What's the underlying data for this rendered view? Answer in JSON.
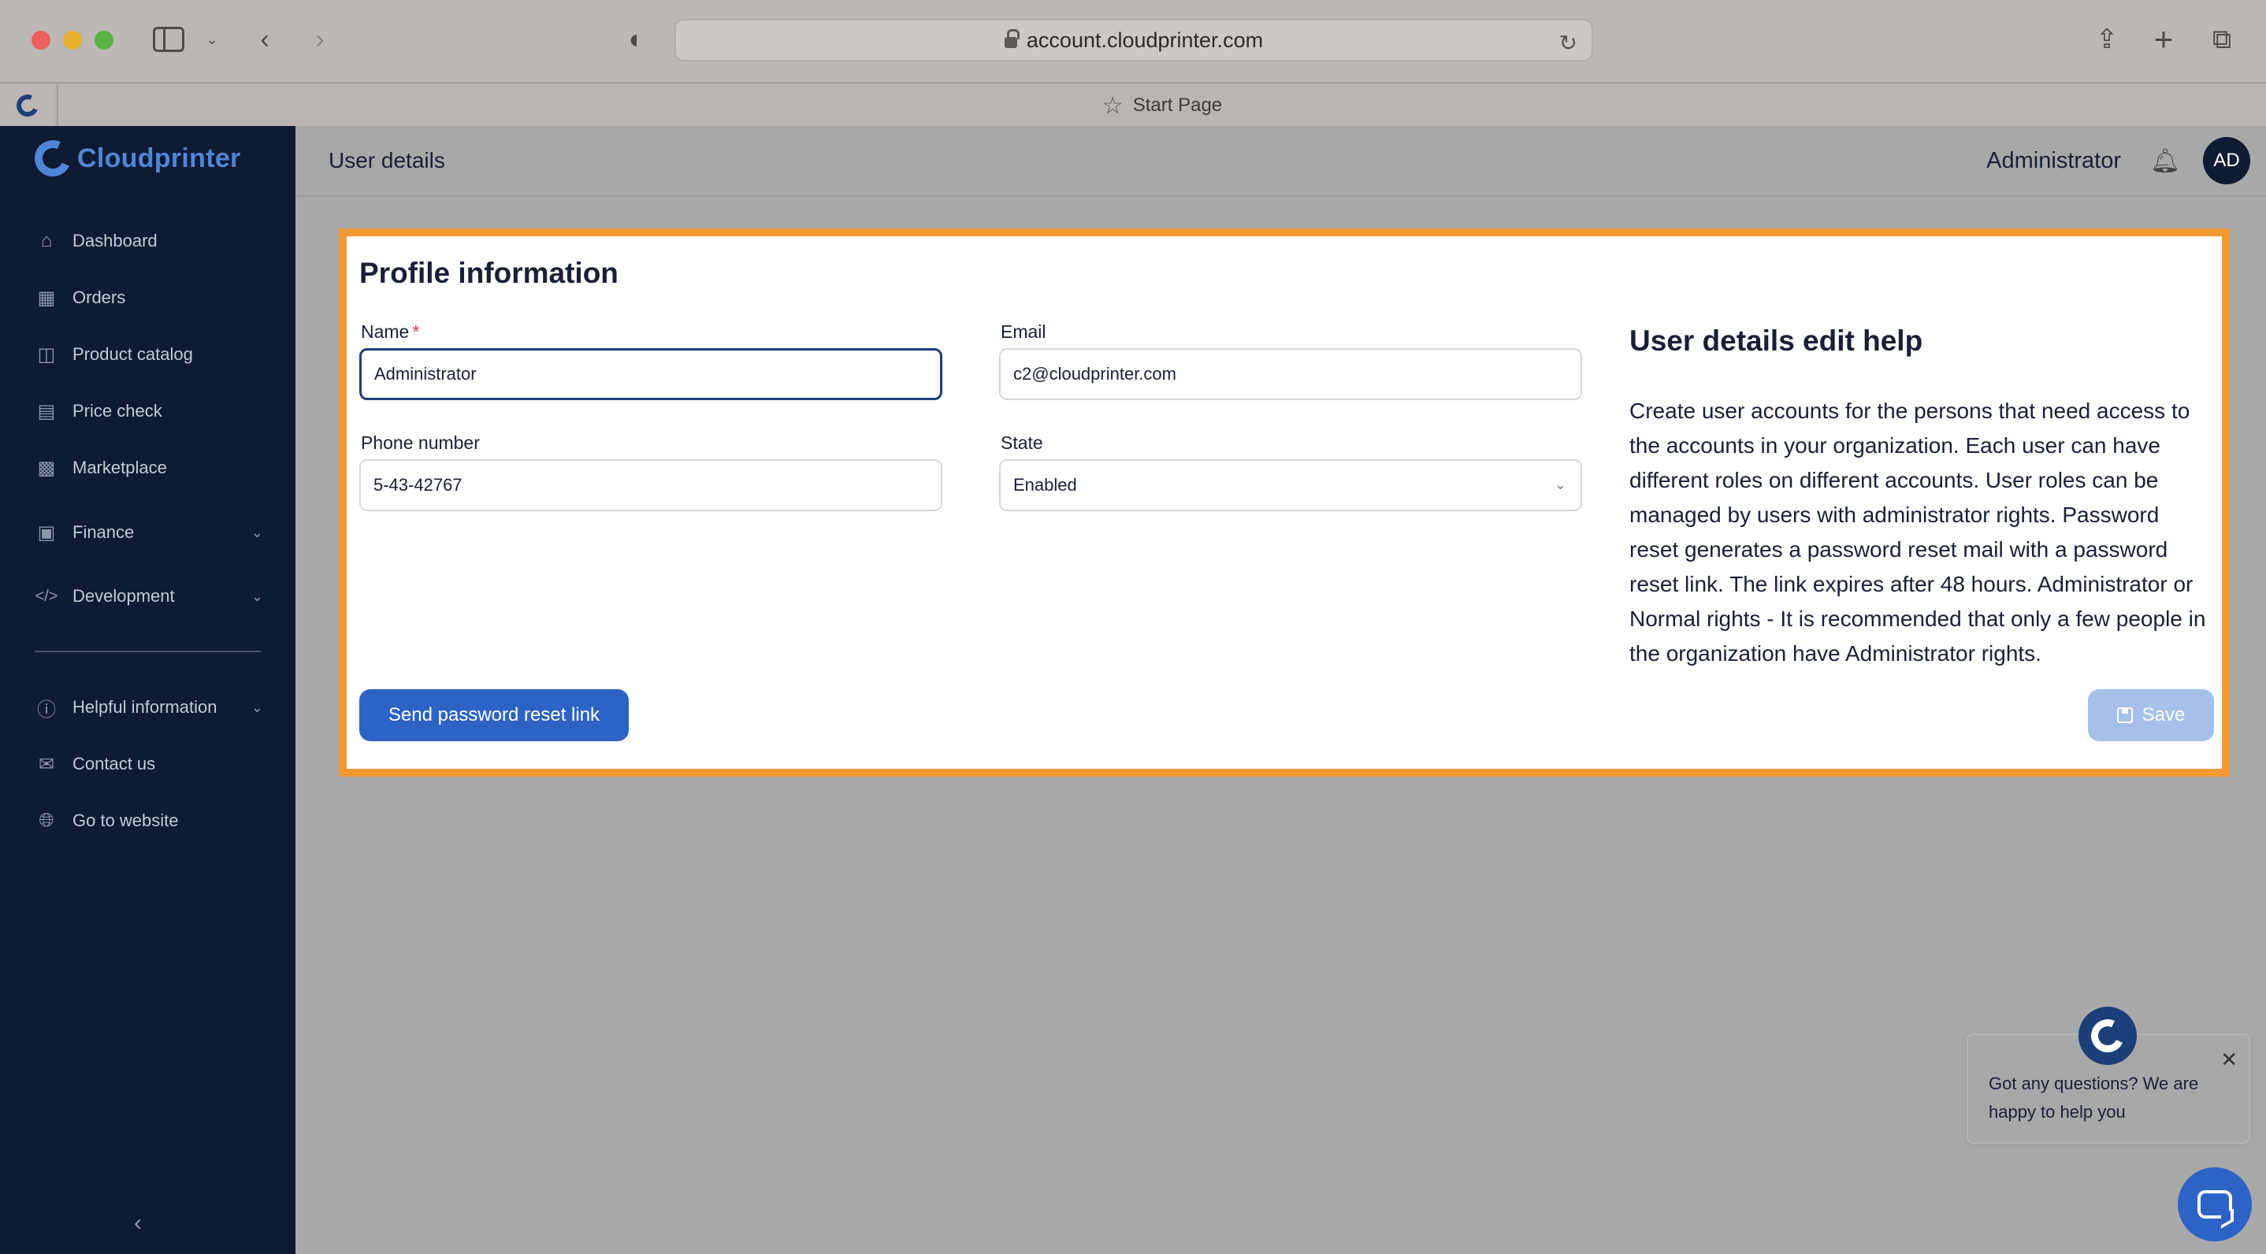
{
  "browser": {
    "url": "account.cloudprinter.com",
    "tab_title": "Start Page"
  },
  "brand": {
    "name": "Cloudprinter",
    "accent_color": "#4f86d8"
  },
  "sidebar": {
    "items": [
      {
        "label": "Dashboard",
        "icon": "home-icon"
      },
      {
        "label": "Orders",
        "icon": "orders-icon"
      },
      {
        "label": "Product catalog",
        "icon": "catalog-icon"
      },
      {
        "label": "Price check",
        "icon": "receipt-icon"
      },
      {
        "label": "Marketplace",
        "icon": "marketplace-icon"
      },
      {
        "label": "Finance",
        "icon": "finance-icon",
        "expandable": true
      },
      {
        "label": "Development",
        "icon": "code-icon",
        "expandable": true
      }
    ],
    "secondary_items": [
      {
        "label": "Helpful information",
        "icon": "question-icon",
        "expandable": true
      },
      {
        "label": "Contact us",
        "icon": "chat-icon"
      },
      {
        "label": "Go to website",
        "icon": "globe-icon"
      }
    ]
  },
  "header": {
    "title": "User details",
    "user_name": "Administrator",
    "avatar_initials": "AD"
  },
  "profile": {
    "heading": "Profile information",
    "name_label": "Name",
    "required_marker": "*",
    "name_value": "Administrator",
    "email_label": "Email",
    "email_value": "c2@cloudprinter.com",
    "phone_label": "Phone number",
    "phone_value": "5-43-42767",
    "state_label": "State",
    "state_value": "Enabled",
    "reset_button": "Send password reset link",
    "save_button": "Save",
    "highlight_color": "#f19a34"
  },
  "help": {
    "title": "User details edit help",
    "body": "Create user accounts for the persons that need access to the accounts in your organization. Each user can have different roles on different accounts. User roles can be managed by users with administrator rights. Password reset generates a password reset mail with a password reset link. The link expires after 48 hours. Administrator or Normal rights - It is recommended that only a few people in the organization have Administrator rights."
  },
  "chat": {
    "message": "Got any questions? We are happy to help you"
  }
}
